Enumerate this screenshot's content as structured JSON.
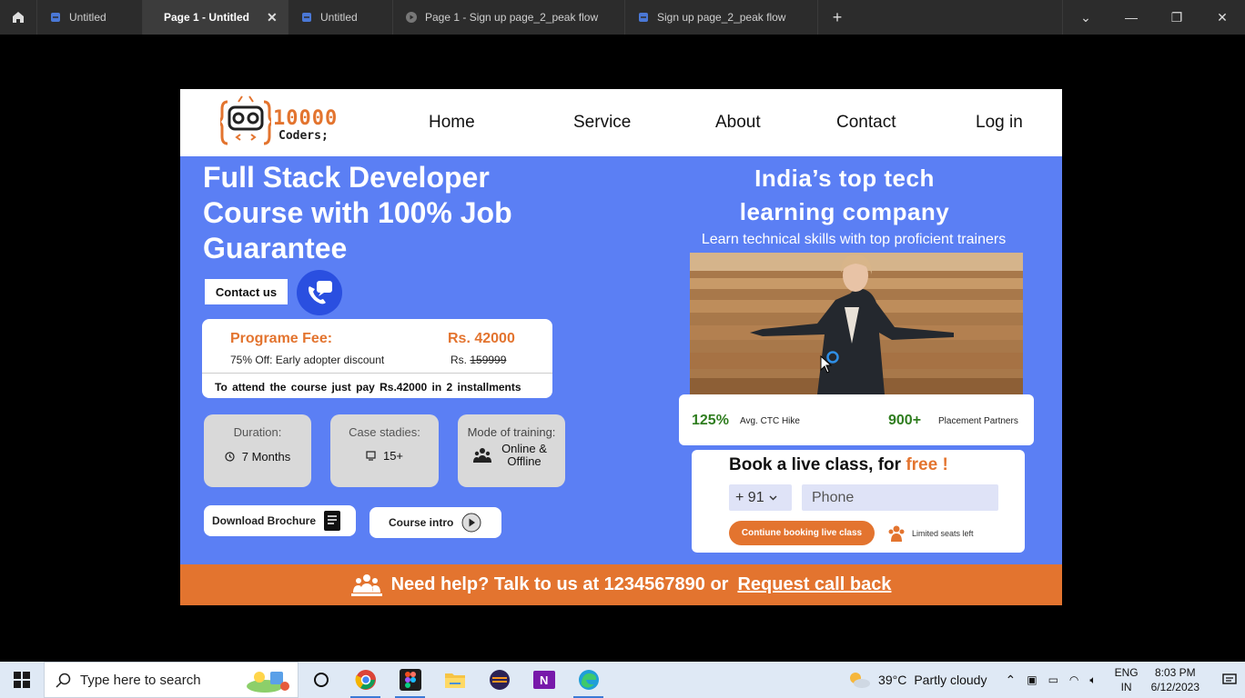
{
  "tabs": [
    {
      "label": "Untitled",
      "type": "figma-file",
      "active": false
    },
    {
      "label": "Page 1 - Untitled",
      "type": "prototype",
      "active": true
    },
    {
      "label": "Untitled",
      "type": "figma-file",
      "active": false
    },
    {
      "label": "Page 1 - Sign up page_2_peak flow",
      "type": "prototype",
      "active": false
    },
    {
      "label": "Sign up page_2_peak flow",
      "type": "figma-file",
      "active": false
    }
  ],
  "nav": {
    "logo_number": "10000",
    "logo_word": "Coders;",
    "items": [
      "Home",
      "Service",
      "About",
      "Contact",
      "Log in"
    ]
  },
  "hero": {
    "title": "Full Stack Developer Course with 100% Job Guarantee",
    "contact_button": "Contact us"
  },
  "fee": {
    "label": "Programe Fee:",
    "amount": "Rs. 42000",
    "discount": "75% Off: Early adopter discount",
    "old_prefix": "Rs.",
    "old_price": "159999",
    "note": "To attend the course just pay Rs.42000 in 2 installments"
  },
  "info_boxes": [
    {
      "title": "Duration:",
      "value": "7 Months",
      "icon": "clock-icon"
    },
    {
      "title": "Case stadies:",
      "value": "15+",
      "icon": "monitor-icon"
    },
    {
      "title": "Mode of training:",
      "value": "Online & Offline",
      "icon": "people-icon"
    }
  ],
  "buttons": {
    "brochure": "Download Brochure",
    "intro": "Course intro"
  },
  "right": {
    "heading_line1": "India’s top tech",
    "heading_line2": "learning company",
    "subtitle": "Learn technical skills with top proficient trainers"
  },
  "stats": {
    "hike_value": "125%",
    "hike_label": "Avg. CTC Hike",
    "partners_value": "900+",
    "partners_label": "Placement Partners"
  },
  "booking": {
    "title_prefix": "Book a live class, for",
    "title_free": "free !",
    "country_code": "+ 91",
    "phone_placeholder": "Phone",
    "button": "Contiune booking live class",
    "seats": "Limited seats left"
  },
  "footer": {
    "text": "Need help? Talk to us at 1234567890  or",
    "link": "Request call back"
  },
  "taskbar": {
    "search_placeholder": "Type here to search",
    "temperature": "39°C",
    "weather": "Partly cloudy",
    "lang_line1": "ENG",
    "lang_line2": "IN",
    "time": "8:03 PM",
    "date": "6/12/2023"
  },
  "colors": {
    "accent_orange": "#e3742f",
    "hero_blue": "#5b7ff4",
    "stat_green": "#2f7d1f"
  }
}
